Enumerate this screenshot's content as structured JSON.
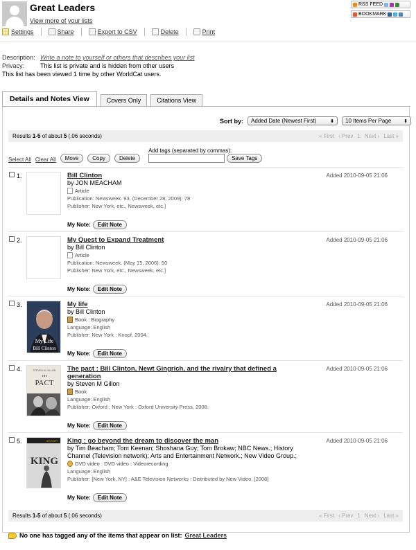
{
  "header": {
    "title": "Great Leaders",
    "view_more": "View more of your lists",
    "share": {
      "rss": "RSS FEED",
      "bookmark": "BOOKMARK"
    }
  },
  "toolbar": {
    "settings": "Settings",
    "share": "Share",
    "export": "Export to CSV",
    "delete": "Delete",
    "print": "Print"
  },
  "details": {
    "description_label": "Description:",
    "description_placeholder": "Write a note to yourself or others that describes your list",
    "privacy_label": "Privacy:",
    "privacy_value": "This list is private and is hidden from other users",
    "views": "This list has been viewed 1 time by other WorldCat users."
  },
  "tabs": [
    "Details and Notes View",
    "Covers Only",
    "Citations View"
  ],
  "sort": {
    "label": "Sort by:",
    "selected": "Added Date (Newest First)",
    "per_page": "10 Items Per Page"
  },
  "results": {
    "prefix": "Results ",
    "range": "1-5",
    "mid": " of about ",
    "count": "5",
    "suffix": " (.06 seconds)",
    "pager": {
      "first": "« First",
      "prev": "‹ Prev",
      "page": "1",
      "next": "Next ›",
      "last": "Last »"
    }
  },
  "actions": {
    "select_all": "Select All",
    "clear_all": "Clear All",
    "move": "Move",
    "copy": "Copy",
    "delete": "Delete",
    "tags_label": "Add tags (separated by commas):",
    "save_tags": "Save Tags"
  },
  "items": [
    {
      "num": "1.",
      "title": "Bill Clinton",
      "by": "by JON MEACHAM",
      "format": "Article",
      "format_icon": "article-icon",
      "meta": [
        "Publication: Newsweek. 93, (December 28, 2009): 78",
        "Publisher: New York, etc., Newsweek, etc.]"
      ],
      "added": "Added 2010-09-05 21:06",
      "note_label": "My Note:",
      "note_button": "Edit Note"
    },
    {
      "num": "2.",
      "title": "My Quest to Expand Treatment",
      "by": "by Bill Clinton",
      "format": "Article",
      "format_icon": "article-icon",
      "meta": [
        "Publication: Newsweek. (May 15, 2006): 50",
        "Publisher: New York, etc., Newsweek, etc.]"
      ],
      "added": "Added 2010-09-05 21:06",
      "note_label": "My Note:",
      "note_button": "Edit Note"
    },
    {
      "num": "3.",
      "title": "My life",
      "by": "by Bill Clinton",
      "format": "Book : Biography",
      "format_icon": "book-icon",
      "meta": [
        "Language: English",
        "Publisher: New York : Knopf, 2004."
      ],
      "added": "Added 2010-09-05 21:06",
      "note_label": "My Note:",
      "note_button": "Edit Note",
      "cover_text": [
        "My Life",
        "Bill Clinton"
      ]
    },
    {
      "num": "4.",
      "title": "The pact : Bill Clinton, Newt Gingrich, and the rivalry that defined a generation",
      "by": "by Steven M Gillon",
      "format": "Book",
      "format_icon": "book-icon",
      "meta": [
        "Language: English",
        "Publisher: Oxford ; New York : Oxford University Press, 2008."
      ],
      "added": "Added 2010-09-05 21:06",
      "note_label": "My Note:",
      "note_button": "Edit Note",
      "cover_text": [
        "THE",
        "PACT",
        "STEVEN M. GILLON"
      ]
    },
    {
      "num": "5.",
      "title": "King : go beyond the dream to discover the man",
      "by": "by Tim Beacham; Tom Keenan; Shoshana Guy; Tom Brokaw; NBC News.; History Channel (Television network); Arts and Entertainment Network.; New Video Group.;",
      "format": "DVD video : DVD video : Videorecording",
      "format_icon": "dvd-icon",
      "meta": [
        "Language: English",
        "Publisher: [New York, NY] : A&E Television Networks : Distributed by New Video, [2008]"
      ],
      "added": "Added 2010-09-05 21:06",
      "note_label": "My Note:",
      "note_button": "Edit Note",
      "cover_text": [
        "HISTORY",
        "KING"
      ]
    }
  ],
  "footer": {
    "text": "No one has tagged any of the items that appear on list:",
    "list_link": "Great Leaders"
  }
}
